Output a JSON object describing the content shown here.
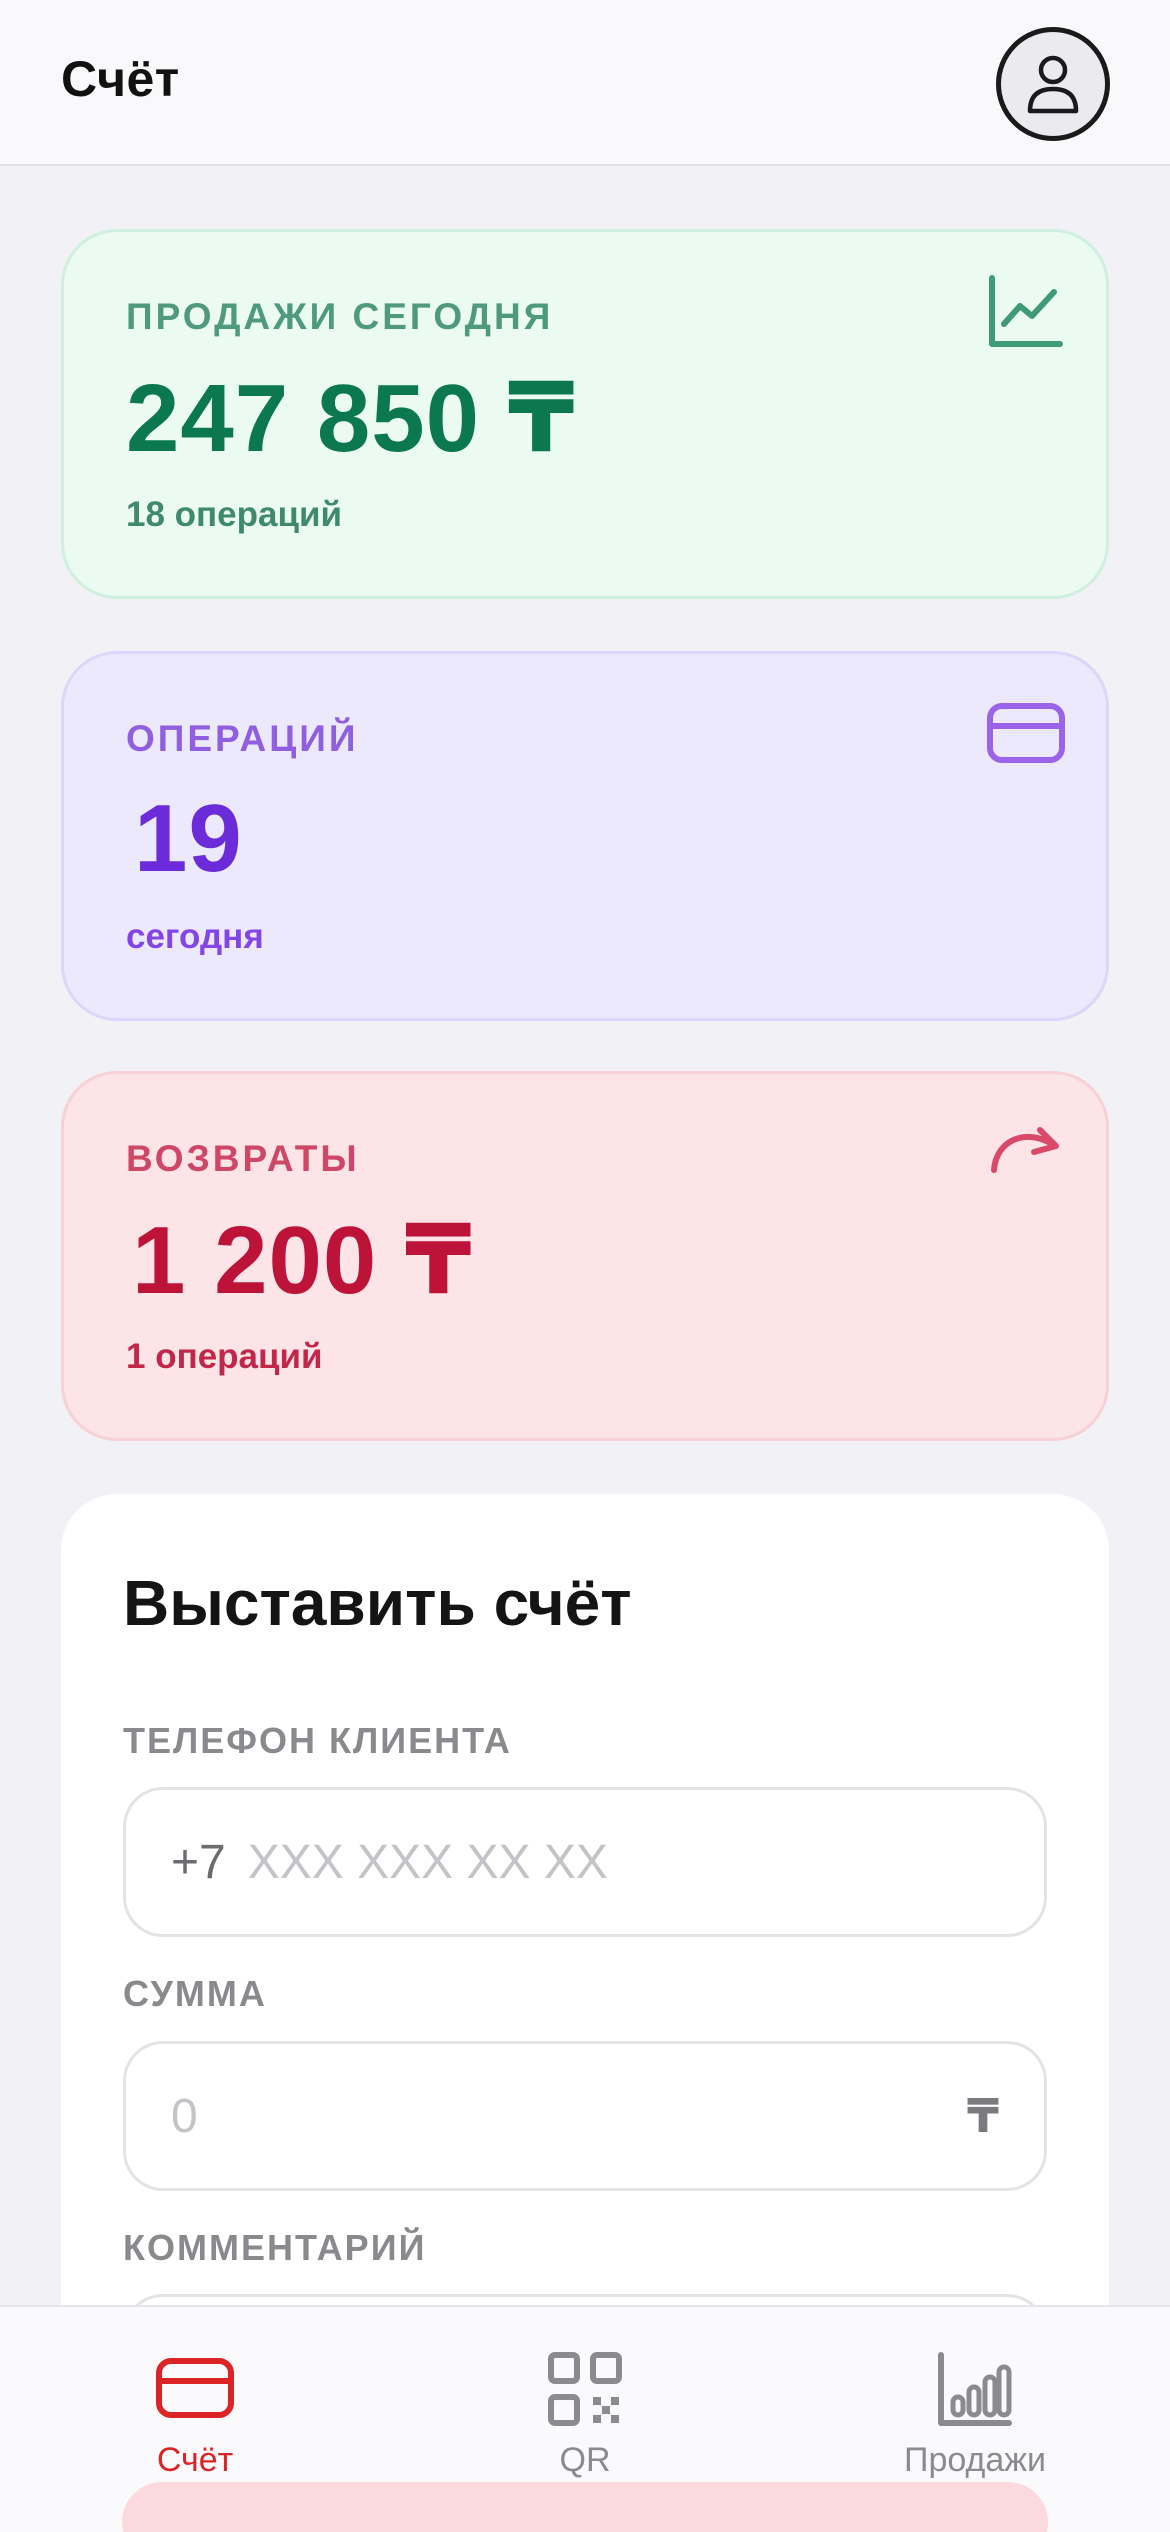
{
  "header": {
    "title": "Счёт"
  },
  "stats": {
    "sales": {
      "label": "ПРОДАЖИ СЕГОДНЯ",
      "value": "247 850 ₸",
      "sub": "18 операций",
      "icon": "chart-line-icon"
    },
    "operations": {
      "label": "ОПЕРАЦИЙ",
      "value": "19",
      "sub": "сегодня",
      "icon": "credit-card-icon"
    },
    "refunds": {
      "label": "ВОЗВРАТЫ",
      "value": "1 200 ₸",
      "sub": "1 операций",
      "icon": "redo-arrow-icon"
    }
  },
  "invoice": {
    "title": "Выставить счёт",
    "phone": {
      "label": "ТЕЛЕФОН КЛИЕНТА",
      "prefix": "+7",
      "placeholder": "XXX XXX XX XX"
    },
    "amount": {
      "label": "СУММА",
      "placeholder": "0",
      "currency": "₸"
    },
    "comment": {
      "label": "КОММЕНТАРИЙ"
    }
  },
  "nav": {
    "items": [
      {
        "label": "Счёт",
        "icon": "credit-card-icon",
        "active": true
      },
      {
        "label": "QR",
        "icon": "qr-code-icon",
        "active": false
      },
      {
        "label": "Продажи",
        "icon": "bar-chart-icon",
        "active": false
      }
    ]
  },
  "colors": {
    "accent": "#dc2426",
    "sales": "#0b7850",
    "operations": "#6c2bd9",
    "refunds": "#be1338"
  }
}
